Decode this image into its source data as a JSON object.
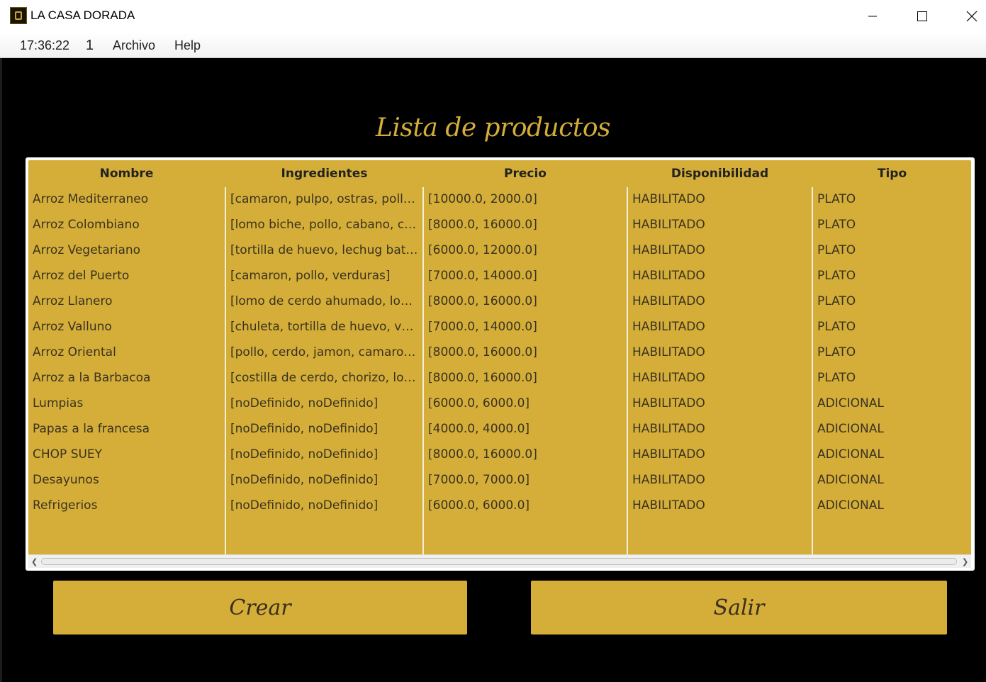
{
  "window": {
    "title": "LA CASA DORADA",
    "controls": {
      "minimize": "minimize-icon",
      "maximize": "maximize-icon",
      "close": "close-icon"
    }
  },
  "menubar": {
    "clock": "17:36:22",
    "counter": "1",
    "archivo": "Archivo",
    "help": "Help"
  },
  "page": {
    "title": "Lista de productos"
  },
  "table": {
    "headers": [
      "Nombre",
      "Ingredientes",
      "Precio",
      "Disponibilidad",
      "Tipo"
    ],
    "rows": [
      [
        "Arroz Mediterraneo",
        "[camaron, pulpo, ostras, pollo, c...",
        "[10000.0, 2000.0]",
        "HABILITADO",
        "PLATO"
      ],
      [
        "Arroz Colombiano",
        "[lomo biche, pollo, cabano, chic...",
        "[8000.0, 16000.0]",
        "HABILITADO",
        "PLATO"
      ],
      [
        "Arroz Vegetariano",
        "[tortilla de huevo, lechug batavi...",
        "[6000.0, 12000.0]",
        "HABILITADO",
        "PLATO"
      ],
      [
        "Arroz del Puerto",
        "[camaron, pollo, verduras]",
        "[7000.0, 14000.0]",
        "HABILITADO",
        "PLATO"
      ],
      [
        "Arroz Llanero",
        "[lomo de cerdo ahumado, lomo...",
        "[8000.0, 16000.0]",
        "HABILITADO",
        "PLATO"
      ],
      [
        "Arroz Valluno",
        "[chuleta, tortilla de huevo, verd...",
        "[7000.0, 14000.0]",
        "HABILITADO",
        "PLATO"
      ],
      [
        "Arroz Oriental",
        "[pollo, cerdo, jamon, camaron, r...",
        "[8000.0, 16000.0]",
        "HABILITADO",
        "PLATO"
      ],
      [
        "Arroz a la Barbacoa",
        "[costilla de cerdo, chorizo, lomo...",
        "[8000.0, 16000.0]",
        "HABILITADO",
        "PLATO"
      ],
      [
        "Lumpias",
        "[noDefinido, noDefinido]",
        "[6000.0, 6000.0]",
        "HABILITADO",
        "ADICIONAL"
      ],
      [
        "Papas a la francesa",
        "[noDefinido, noDefinido]",
        "[4000.0, 4000.0]",
        "HABILITADO",
        "ADICIONAL"
      ],
      [
        "CHOP SUEY",
        "[noDefinido, noDefinido]",
        "[8000.0, 16000.0]",
        "HABILITADO",
        "ADICIONAL"
      ],
      [
        "Desayunos",
        "[noDefinido, noDefinido]",
        "[7000.0, 7000.0]",
        "HABILITADO",
        "ADICIONAL"
      ],
      [
        "Refrigerios",
        "[noDefinido, noDefinido]",
        "[6000.0, 6000.0]",
        "HABILITADO",
        "ADICIONAL"
      ]
    ]
  },
  "buttons": {
    "crear": "Crear",
    "salir": "Salir"
  },
  "colors": {
    "accent": "#d4ae38",
    "background": "#000000",
    "text_dark": "#3a3220"
  }
}
